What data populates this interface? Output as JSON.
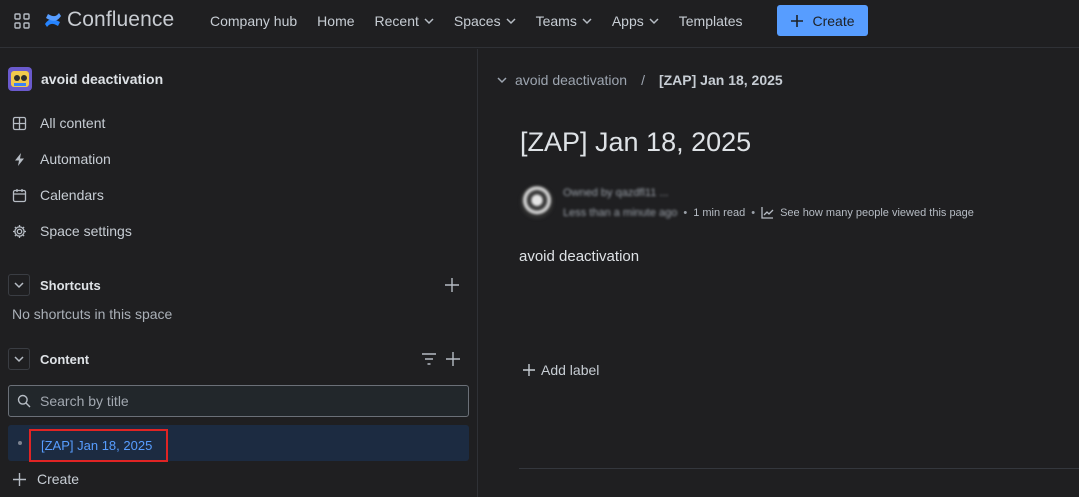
{
  "topbar": {
    "product_name": "Confluence",
    "nav": [
      {
        "label": "Company hub",
        "dropdown": false
      },
      {
        "label": "Home",
        "dropdown": false
      },
      {
        "label": "Recent",
        "dropdown": true
      },
      {
        "label": "Spaces",
        "dropdown": true
      },
      {
        "label": "Teams",
        "dropdown": true
      },
      {
        "label": "Apps",
        "dropdown": true
      },
      {
        "label": "Templates",
        "dropdown": false
      }
    ],
    "create_label": "Create"
  },
  "sidebar": {
    "space_name": "avoid deactivation",
    "items": [
      {
        "label": "All content",
        "icon": "grid-icon"
      },
      {
        "label": "Automation",
        "icon": "lightning-icon"
      },
      {
        "label": "Calendars",
        "icon": "calendar-icon"
      },
      {
        "label": "Space settings",
        "icon": "gear-icon"
      }
    ],
    "shortcuts": {
      "title": "Shortcuts",
      "empty_text": "No shortcuts in this space"
    },
    "content": {
      "title": "Content",
      "search_placeholder": "Search by title",
      "pages": [
        "[ZAP] Jan 18, 2025"
      ]
    },
    "create_label": "Create"
  },
  "main": {
    "breadcrumb": {
      "space": "avoid deactivation",
      "separator": "/",
      "page": "[ZAP] Jan 18, 2025"
    },
    "title": "[ZAP] Jan 18, 2025",
    "byline": {
      "owner_text": "Owned by qazdfl11 ...",
      "updated_text": "Less than a minute ago",
      "read_time": "1 min read",
      "views_link": "See how many people viewed this page"
    },
    "body_text": "avoid deactivation",
    "add_label": "Add label"
  },
  "colors": {
    "background": "#1f1f21",
    "accent": "#579dff",
    "selected_row": "#1c2b41",
    "highlight_border": "#e02424"
  }
}
